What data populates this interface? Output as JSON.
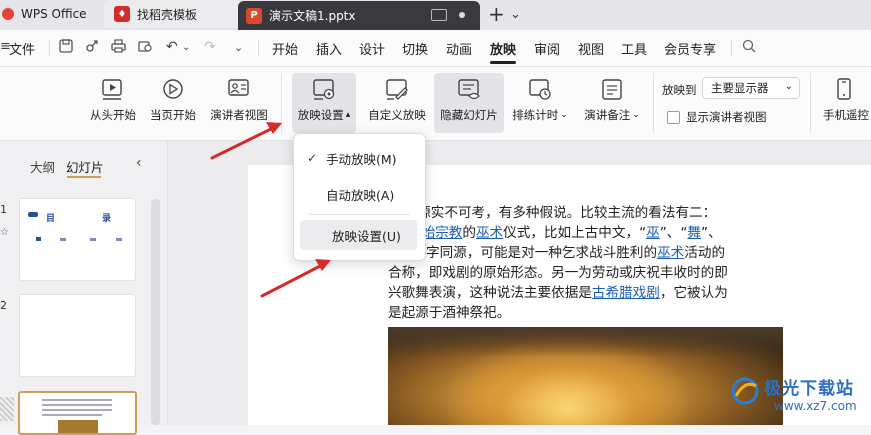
{
  "tabs": {
    "home": "WPS Office",
    "templates": "找稻壳模板",
    "document": "演示文稿1.pptx",
    "add_label": "+",
    "more_label": "⌄"
  },
  "menubar": {
    "file": "文件",
    "items": [
      "开始",
      "插入",
      "设计",
      "切换",
      "动画",
      "放映",
      "审阅",
      "视图",
      "工具",
      "会员专享"
    ],
    "active": "放映"
  },
  "ribbon": {
    "from_start": "从头开始",
    "from_current": "当页开始",
    "presenter_view": "演讲者视图",
    "slideshow_settings": "放映设置",
    "custom_show": "自定义放映",
    "hide_slide": "隐藏幻灯片",
    "rehearse": "排练计时",
    "speaker_notes": "演讲备注",
    "show_on_label": "放映到",
    "show_on_value": "主要显示器",
    "show_presenter_checkbox": "显示演讲者视图",
    "phone_remote": "手机遥控"
  },
  "dropdown": {
    "manual": "手动放映(M)",
    "auto": "自动放映(A)",
    "settings": "放映设置(U)",
    "checked": "manual"
  },
  "leftpanel": {
    "outline_tab": "大纲",
    "slides_tab": "幻灯片",
    "slide_numbers": [
      "1",
      "2"
    ],
    "thumb1_title_a": "目",
    "thumb1_title_b": "录"
  },
  "slide": {
    "line1": "的起源实不可考，有多种假说。比较主流的看法有二：",
    "line2_a": "原始宗教",
    "line2_b": "的",
    "line2_c": "巫术",
    "line2_d": "仪式，比如上古中文，“",
    "line2_e": "巫",
    "line2_f": "”、“",
    "line2_g": "舞",
    "line2_h": "”、",
    "line3_a": "字同源，可能是对一种乞求战斗胜利的",
    "line3_b": "巫术",
    "line3_c": "活动的",
    "line4": "合称，即戏剧的原始形态。另一为劳动或庆祝丰收时的即",
    "line5_a": "兴歌舞表演，这种说法主要依据是",
    "line5_b": "古希腊戏剧",
    "line5_c": "，它被认为",
    "line6": "是起源于酒神祭祀。"
  },
  "watermark": {
    "name": "极光下载站",
    "url": "www.xz7.com"
  },
  "colors": {
    "accent": "#c0392b",
    "link": "#1a5fb4",
    "arrow": "#d62b2b",
    "wps_red": "#e8423a"
  }
}
